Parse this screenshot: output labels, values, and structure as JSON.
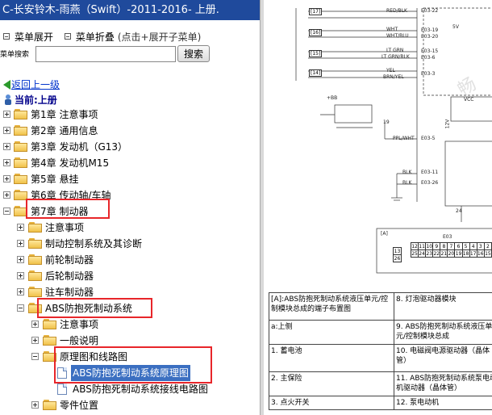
{
  "window_title": "C-长安铃木-雨燕（Swift）-2011-2016- 上册.",
  "toolbar": {
    "expand_menu": "菜单展开",
    "fold_menu": "菜单折叠",
    "fold_hint": "(点击+展开子菜单)",
    "search_label": "菜单搜索",
    "search_button": "搜索",
    "search_value": "",
    "back_link": "返回上一级",
    "current_label": "当前:上册"
  },
  "tree": [
    {
      "label": "第1章 注意事项"
    },
    {
      "label": "第2章 通用信息"
    },
    {
      "label": "第3章 发动机（G13）"
    },
    {
      "label": "第4章 发动机M15"
    },
    {
      "label": "第5章 悬挂"
    },
    {
      "label": "第6章 传动轴/车轴"
    },
    {
      "label": "第7章 制动器"
    },
    {
      "label": "注意事项"
    },
    {
      "label": "制动控制系统及其诊断"
    },
    {
      "label": "前轮制动器"
    },
    {
      "label": "后轮制动器"
    },
    {
      "label": "驻车制动器"
    },
    {
      "label": "ABS防抱死制动系统"
    },
    {
      "label": "注意事项"
    },
    {
      "label": "一般说明"
    },
    {
      "label": "原理图和线路图"
    },
    {
      "label": "ABS防抱死制动系统原理图"
    },
    {
      "label": "ABS防抱死制动系统接线电路图"
    },
    {
      "label": "零件位置"
    }
  ],
  "diagram": {
    "signals": [
      "RED/BLK",
      "WHT",
      "WHT/BLU",
      "LT GRN",
      "LT GRN/BLK",
      "YEL",
      "BRN/YEL",
      "+BB",
      "PPL/WHT",
      "BLK",
      "BLK",
      "VCC",
      "12V",
      "5V",
      "19",
      "24",
      "E03-22",
      "E03-19",
      "E03-20",
      "E03-15",
      "E03-6",
      "E03-3",
      "E03-5",
      "E03-11",
      "E03-26",
      "E03",
      "[A]"
    ],
    "pins": [
      "[17]",
      "[16]",
      "[15]",
      "[14]"
    ],
    "connector_top": [
      "12",
      "11",
      "10",
      "9",
      "8",
      "7",
      "6",
      "5",
      "4",
      "3",
      "2"
    ],
    "connector_bottom": [
      "25",
      "24",
      "23",
      "22",
      "21",
      "20",
      "19",
      "18",
      "17",
      "16",
      "15"
    ],
    "connector_left": [
      "13",
      "26"
    ],
    "watermark": "畅"
  },
  "spec_table": [
    [
      "[A]:ABS防抱死制动系统液压单元/控制模块总成的端子布置图",
      "8. 灯泡驱动器模块"
    ],
    [
      "a:上侧",
      "9. ABS防抱死制动系统液压单元/控制模块总成"
    ],
    [
      "1. 蓄电池",
      "10. 电磁阀电源驱动器（晶体管）"
    ],
    [
      "2. 主保险",
      "11. ABS防抱死制动系统泵电动机驱动器（晶体管）"
    ],
    [
      "3. 点火开关",
      "12. 泵电动机"
    ]
  ]
}
